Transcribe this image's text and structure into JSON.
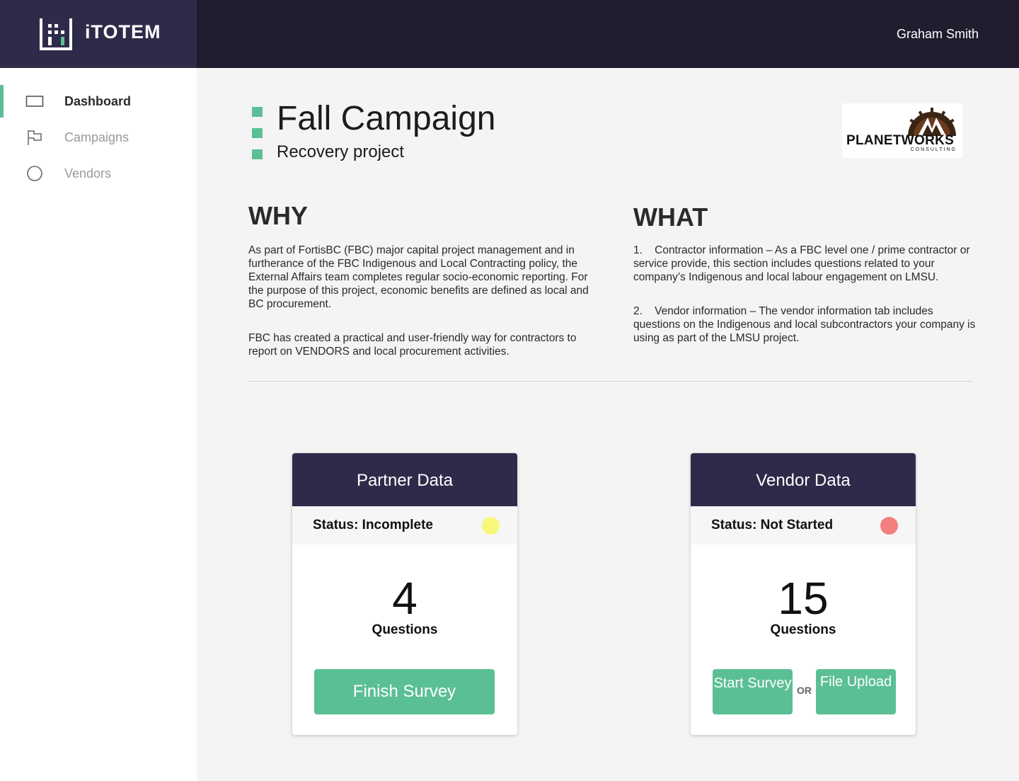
{
  "brand": {
    "name": "iTOTEM",
    "logo_icon": "itotem-logo-icon"
  },
  "header": {
    "user_name": "Graham Smith"
  },
  "sidebar": {
    "items": [
      {
        "label": "Dashboard",
        "icon": "dashboard-icon",
        "active": true
      },
      {
        "label": "Campaigns",
        "icon": "flag-icon",
        "active": false
      },
      {
        "label": "Vendors",
        "icon": "circle-icon",
        "active": false
      }
    ]
  },
  "page": {
    "title": "Fall Campaign",
    "subtitle": "Recovery project",
    "company_logo": {
      "name": "PLANETWORKS",
      "sub": "CONSULTING"
    }
  },
  "why": {
    "heading": "WHY",
    "paragraphs": [
      "As part of FortisBC (FBC) major capital project management and in furtherance of the FBC Indigenous and Local Contracting policy, the External Affairs team completes regular socio-economic reporting. For the purpose of this project, economic benefits are defined as local and BC procurement.",
      "FBC has created a practical and user-friendly way for contractors to report on VENDORS and local procurement activities."
    ]
  },
  "what": {
    "heading": "WHAT",
    "items": [
      "1.    Contractor information – As a FBC level one / prime contractor or service provide, this section includes questions related to your company’s Indigenous and local labour engagement on LMSU.",
      "2.    Vendor information – The vendor information tab includes questions on the Indigenous and local subcontractors your company is using as part of the LMSU project."
    ]
  },
  "cards": [
    {
      "title": "Partner Data",
      "status": "Status: Incomplete",
      "status_color": "#f7f77a",
      "count": "4",
      "count_label": "Questions",
      "button": "Finish Survey"
    },
    {
      "title": "Vendor Data",
      "status": "Status: Not Started",
      "status_color": "#f47f7f",
      "count": "15",
      "count_label": "Questions",
      "button_start": "Start Survey",
      "or": "OR",
      "button_upload": "File Upload"
    }
  ],
  "colors": {
    "accent": "#5bbf95",
    "navy": "#2e2b4a",
    "topbar": "#1f1d2e"
  }
}
